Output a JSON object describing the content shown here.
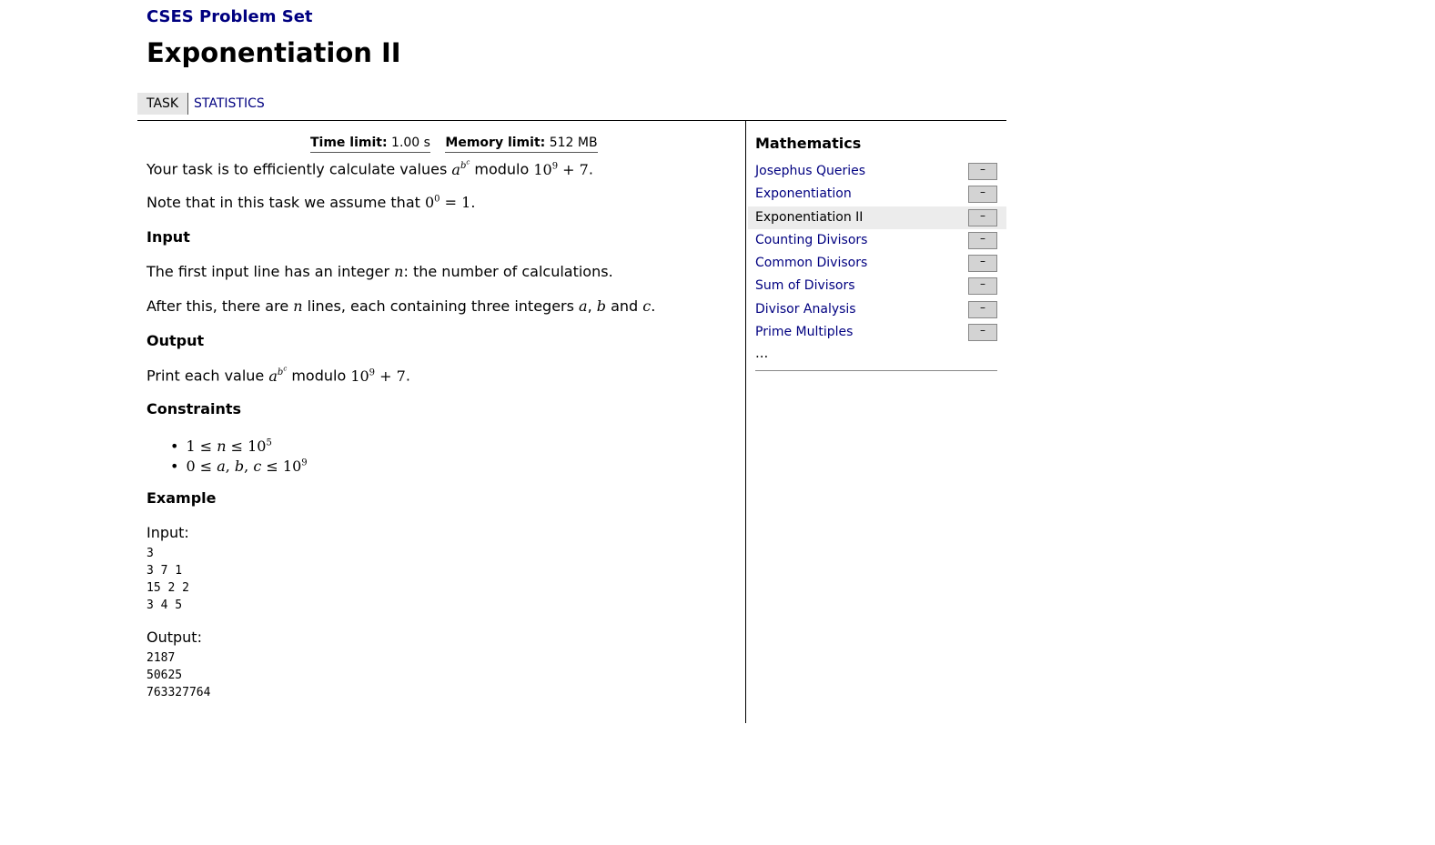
{
  "site": {
    "title": "CSES Problem Set"
  },
  "page": {
    "title": "Exponentiation II"
  },
  "tabs": [
    {
      "label": "TASK",
      "active": true
    },
    {
      "label": "STATISTICS",
      "active": false
    }
  ],
  "limits": {
    "time_label": "Time limit:",
    "time_value": "1.00 s",
    "memory_label": "Memory limit:",
    "memory_value": "512 MB"
  },
  "statement": {
    "intro_prefix": "Your task is to efficiently calculate values ",
    "intro_suffix": " modulo ",
    "note_prefix": "Note that in this task we assume that ",
    "input_heading": "Input",
    "input_line1_prefix": "The first input line has an integer ",
    "input_line1_suffix": ": the number of calculations.",
    "input_line2_prefix": "After this, there are ",
    "input_line2_mid": " lines, each containing three integers ",
    "input_line2_and": " and ",
    "output_heading": "Output",
    "output_prefix": "Print each value ",
    "output_mid": " modulo ",
    "constraints_heading": "Constraints",
    "example_heading": "Example",
    "example_input_label": "Input:",
    "example_input": "3\n3 7 1\n15 2 2\n3 4 5",
    "example_output_label": "Output:",
    "example_output": "2187\n50625\n763327764"
  },
  "nav": {
    "title": "Mathematics",
    "items": [
      {
        "label": "Josephus Queries",
        "status": "–"
      },
      {
        "label": "Exponentiation",
        "status": "–"
      },
      {
        "label": "Exponentiation II",
        "status": "–",
        "current": true
      },
      {
        "label": "Counting Divisors",
        "status": "–"
      },
      {
        "label": "Common Divisors",
        "status": "–"
      },
      {
        "label": "Sum of Divisors",
        "status": "–"
      },
      {
        "label": "Divisor Analysis",
        "status": "–"
      },
      {
        "label": "Prime Multiples",
        "status": "–"
      }
    ],
    "more": "..."
  },
  "colors": {
    "link": "#000080",
    "current_bg": "#ececec",
    "status_bg": "#d3d3d3"
  }
}
